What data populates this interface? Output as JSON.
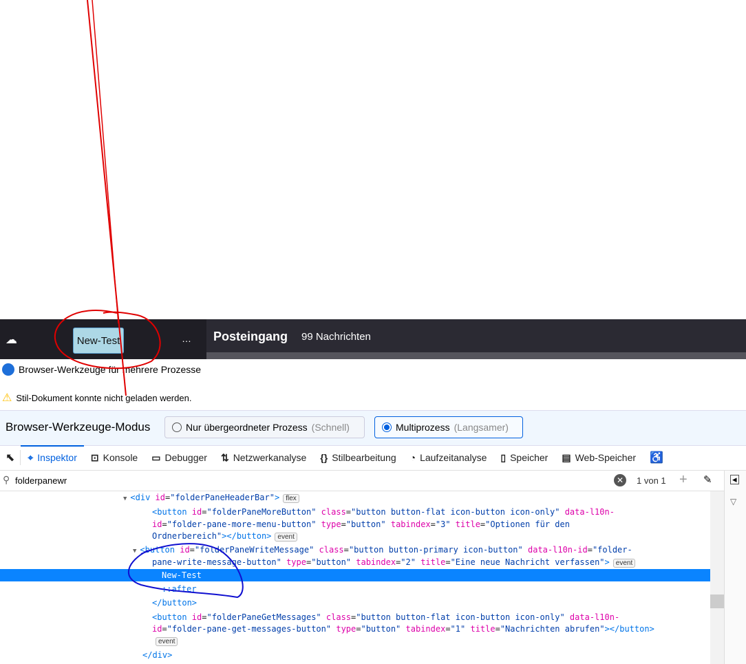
{
  "app_toolbar": {
    "write_button": "New-Test",
    "more": "…",
    "folder_title": "Posteingang",
    "message_count": "99 Nachrichten"
  },
  "devtools": {
    "title": "Browser-Werkzeuge für mehrere Prozesse",
    "warning": "Stil-Dokument konnte nicht geladen werden.",
    "mode_label": "Browser-Werkzeuge-Modus",
    "mode_options": [
      {
        "label": "Nur übergeordneter Prozess",
        "hint": "(Schnell)",
        "selected": false
      },
      {
        "label": "Multiprozess",
        "hint": "(Langsamer)",
        "selected": true
      }
    ],
    "tabs": [
      {
        "label": "Inspektor",
        "icon": "inspector-icon"
      },
      {
        "label": "Konsole",
        "icon": "console-icon"
      },
      {
        "label": "Debugger",
        "icon": "debugger-icon"
      },
      {
        "label": "Netzwerkanalyse",
        "icon": "network-icon"
      },
      {
        "label": "Stilbearbeitung",
        "icon": "style-editor-icon"
      },
      {
        "label": "Laufzeitanalyse",
        "icon": "performance-icon"
      },
      {
        "label": "Speicher",
        "icon": "memory-icon"
      },
      {
        "label": "Web-Speicher",
        "icon": "storage-icon"
      }
    ],
    "search_value": "folderpanewr",
    "search_result": "1 von 1",
    "markup_lines": [
      {
        "indent": 0,
        "arrow": "▼",
        "tokens": [
          [
            "tg",
            "<div "
          ],
          [
            "at",
            "id"
          ],
          [
            "tx",
            "="
          ],
          [
            "vl",
            "\"folderPaneHeaderBar\""
          ],
          [
            "tg",
            ">"
          ]
        ],
        "badge": "flex"
      },
      {
        "indent": 2,
        "tokens": [
          [
            "tg",
            "<button "
          ],
          [
            "at",
            "id"
          ],
          [
            "tx",
            "="
          ],
          [
            "vl",
            "\"folderPaneMoreButton\""
          ],
          [
            "tx",
            " "
          ],
          [
            "at",
            "class"
          ],
          [
            "tx",
            "="
          ],
          [
            "vl",
            "\"button button-flat icon-button icon-only\""
          ],
          [
            "tx",
            " "
          ],
          [
            "at",
            "data-l10n-"
          ]
        ]
      },
      {
        "indent": 2,
        "tokens": [
          [
            "at",
            "id"
          ],
          [
            "tx",
            "="
          ],
          [
            "vl",
            "\"folder-pane-more-menu-button\""
          ],
          [
            "tx",
            " "
          ],
          [
            "at",
            "type"
          ],
          [
            "tx",
            "="
          ],
          [
            "vl",
            "\"button\""
          ],
          [
            "tx",
            " "
          ],
          [
            "at",
            "tabindex"
          ],
          [
            "tx",
            "="
          ],
          [
            "vl",
            "\"3\""
          ],
          [
            "tx",
            " "
          ],
          [
            "at",
            "title"
          ],
          [
            "tx",
            "="
          ],
          [
            "vl",
            "\"Optionen für den"
          ]
        ]
      },
      {
        "indent": 2,
        "tokens": [
          [
            "vl",
            "Ordnerbereich\""
          ],
          [
            "tg",
            "></button>"
          ]
        ],
        "badge": "event"
      },
      {
        "indent": 1,
        "arrow": "▼",
        "tokens": [
          [
            "tg",
            "<button "
          ],
          [
            "at",
            "id"
          ],
          [
            "tx",
            "="
          ],
          [
            "vl",
            "\"folderPaneWriteMessage\""
          ],
          [
            "tx",
            " "
          ],
          [
            "at",
            "class"
          ],
          [
            "tx",
            "="
          ],
          [
            "vl",
            "\"button button-primary icon-button\""
          ],
          [
            "tx",
            " "
          ],
          [
            "at",
            "data-l10n-id"
          ],
          [
            "tx",
            "="
          ],
          [
            "vl",
            "\"folder-"
          ]
        ]
      },
      {
        "indent": 2,
        "tokens": [
          [
            "vl",
            "pane-write-message-button\""
          ],
          [
            "tx",
            " "
          ],
          [
            "at",
            "type"
          ],
          [
            "tx",
            "="
          ],
          [
            "vl",
            "\"button\""
          ],
          [
            "tx",
            " "
          ],
          [
            "at",
            "tabindex"
          ],
          [
            "tx",
            "="
          ],
          [
            "vl",
            "\"2\""
          ],
          [
            "tx",
            " "
          ],
          [
            "at",
            "title"
          ],
          [
            "tx",
            "="
          ],
          [
            "vl",
            "\"Eine neue Nachricht verfassen\""
          ],
          [
            "tg",
            ">"
          ]
        ],
        "badge": "event"
      },
      {
        "indent": 3,
        "selected": true,
        "tokens": [
          [
            "tx",
            "New-Test"
          ]
        ]
      },
      {
        "indent": 3,
        "tokens": [
          [
            "tg",
            "::after"
          ]
        ]
      },
      {
        "indent": 2,
        "tokens": [
          [
            "tg",
            "</button>"
          ]
        ]
      },
      {
        "indent": 2,
        "tokens": [
          [
            "tg",
            "<button "
          ],
          [
            "at",
            "id"
          ],
          [
            "tx",
            "="
          ],
          [
            "vl",
            "\"folderPaneGetMessages\""
          ],
          [
            "tx",
            " "
          ],
          [
            "at",
            "class"
          ],
          [
            "tx",
            "="
          ],
          [
            "vl",
            "\"button button-flat icon-button icon-only\""
          ],
          [
            "tx",
            " "
          ],
          [
            "at",
            "data-l10n-"
          ]
        ]
      },
      {
        "indent": 2,
        "tokens": [
          [
            "at",
            "id"
          ],
          [
            "tx",
            "="
          ],
          [
            "vl",
            "\"folder-pane-get-messages-button\""
          ],
          [
            "tx",
            " "
          ],
          [
            "at",
            "type"
          ],
          [
            "tx",
            "="
          ],
          [
            "vl",
            "\"button\""
          ],
          [
            "tx",
            " "
          ],
          [
            "at",
            "tabindex"
          ],
          [
            "tx",
            "="
          ],
          [
            "vl",
            "\"1\""
          ],
          [
            "tx",
            " "
          ],
          [
            "at",
            "title"
          ],
          [
            "tx",
            "="
          ],
          [
            "vl",
            "\"Nachrichten abrufen\""
          ],
          [
            "tg",
            "></button>"
          ]
        ]
      },
      {
        "indent": 2,
        "tokens": [],
        "badge": "event"
      },
      {
        "indent": 0,
        "tokens": [
          [
            "tg",
            "</div>"
          ]
        ]
      }
    ]
  },
  "annotations": {
    "red": "#e00000",
    "blue": "#1010d0"
  }
}
